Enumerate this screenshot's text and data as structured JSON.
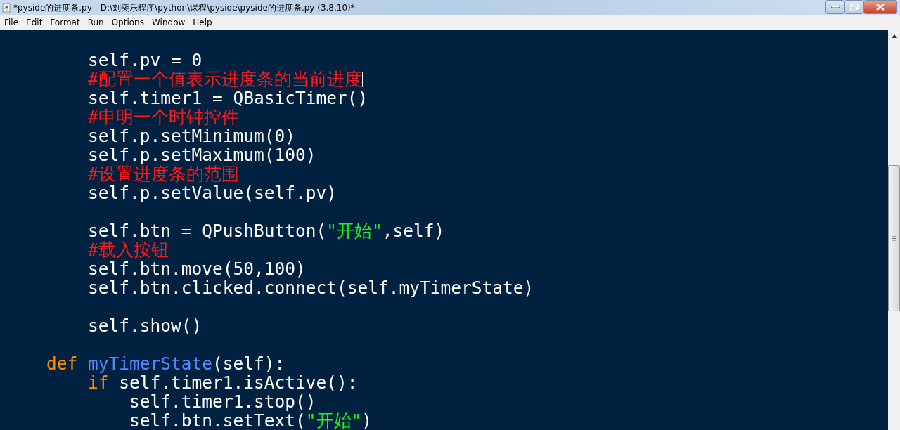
{
  "window": {
    "title": "*pyside的进度条.py - D:\\刘奕乐程序\\python\\课程\\pyside\\pyside的进度条.py (3.8.10)*"
  },
  "menu": [
    "File",
    "Edit",
    "Format",
    "Run",
    "Options",
    "Window",
    "Help"
  ],
  "editor": {
    "lines": [
      {
        "kind": "code",
        "tokens": [
          {
            "kind": "plain",
            "text": "        self.pv = 0"
          }
        ]
      },
      {
        "kind": "code",
        "cursor": true,
        "tokens": [
          {
            "kind": "comment",
            "text": "        #配置一个值表示进度条的当前进度"
          }
        ]
      },
      {
        "kind": "code",
        "tokens": [
          {
            "kind": "plain",
            "text": "        self.timer1 = QBasicTimer()"
          }
        ]
      },
      {
        "kind": "code",
        "tokens": [
          {
            "kind": "comment",
            "text": "        #申明一个时钟控件"
          }
        ]
      },
      {
        "kind": "code",
        "tokens": [
          {
            "kind": "plain",
            "text": "        self.p.setMinimum(0)"
          }
        ]
      },
      {
        "kind": "code",
        "tokens": [
          {
            "kind": "plain",
            "text": "        self.p.setMaximum(100)"
          }
        ]
      },
      {
        "kind": "code",
        "tokens": [
          {
            "kind": "comment",
            "text": "        #设置进度条的范围"
          }
        ]
      },
      {
        "kind": "code",
        "tokens": [
          {
            "kind": "plain",
            "text": "        self.p.setValue(self.pv)"
          }
        ]
      },
      {
        "kind": "blank"
      },
      {
        "kind": "code",
        "tokens": [
          {
            "kind": "plain",
            "text": "        self.btn = QPushButton("
          },
          {
            "kind": "string",
            "text": "\"开始\""
          },
          {
            "kind": "plain",
            "text": ",self)"
          }
        ]
      },
      {
        "kind": "code",
        "tokens": [
          {
            "kind": "comment",
            "text": "        #载入按钮"
          }
        ]
      },
      {
        "kind": "code",
        "tokens": [
          {
            "kind": "plain",
            "text": "        self.btn.move(50,100)"
          }
        ]
      },
      {
        "kind": "code",
        "tokens": [
          {
            "kind": "plain",
            "text": "        self.btn.clicked.connect(self.myTimerState)"
          }
        ]
      },
      {
        "kind": "blank"
      },
      {
        "kind": "code",
        "tokens": [
          {
            "kind": "plain",
            "text": "        self.show()"
          }
        ]
      },
      {
        "kind": "blank"
      },
      {
        "kind": "code",
        "tokens": [
          {
            "kind": "keyword",
            "text": "    def "
          },
          {
            "kind": "defname",
            "text": "myTimerState"
          },
          {
            "kind": "plain",
            "text": "(self):"
          }
        ]
      },
      {
        "kind": "code",
        "tokens": [
          {
            "kind": "keyword",
            "text": "        if"
          },
          {
            "kind": "plain",
            "text": " self.timer1.isActive():"
          }
        ]
      },
      {
        "kind": "code",
        "tokens": [
          {
            "kind": "plain",
            "text": "            self.timer1.stop()"
          }
        ]
      },
      {
        "kind": "code",
        "tokens": [
          {
            "kind": "plain",
            "text": "            self.btn.setText("
          },
          {
            "kind": "string",
            "text": "\"开始\""
          },
          {
            "kind": "plain",
            "text": ")"
          }
        ]
      }
    ]
  }
}
